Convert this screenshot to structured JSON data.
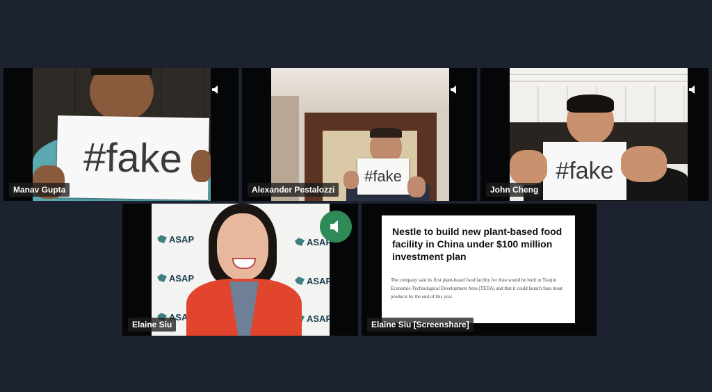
{
  "participants": [
    {
      "name": "Manav Gupta",
      "sign": "#fake"
    },
    {
      "name": "Alexander Pestalozzi",
      "sign": "#fake"
    },
    {
      "name": "John Cheng",
      "sign": "#fake"
    },
    {
      "name": "Elaine Siu",
      "backdrop_logo": "ASAP"
    },
    {
      "name": "Elaine Siu [Screenshare]"
    }
  ],
  "screenshare": {
    "headline": "Nestle to build new plant-based food facility in China under $100 million investment plan",
    "body": "The company said its first plant-based food facility for Asia would be built in Tianjin Economic-Technological Development Area (TEDA) and that it could launch faux meat products by the end of this year."
  },
  "icons": {
    "audio": "speaker-icon",
    "active_speaker": "speaker-icon"
  },
  "colors": {
    "background": "#1c2230",
    "active_speaker": "#2e8b57"
  }
}
